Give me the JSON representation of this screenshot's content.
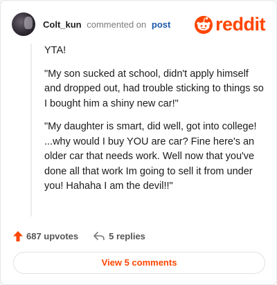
{
  "comment": {
    "username": "Colt_kun",
    "action": "commented on",
    "target": "post",
    "avatar_icon": "user-avatar-icon",
    "brand": {
      "name": "reddit",
      "icon": "reddit-snoo-icon",
      "color": "#ff4500"
    },
    "paragraphs": [
      "YTA!",
      "\"My son sucked at school, didn't apply himself and dropped out, had trouble sticking to things so I bought him a shiny new car!\"",
      "\"My daughter is smart, did well, got into college! ...why would I buy YOU are car? Fine here's an older car that needs work. Well now that you've done all that work Im going to sell it from under you! Hahaha I am the devil!!\""
    ],
    "upvotes_label": "687 upvotes",
    "upvote_icon": "upvote-arrow-icon",
    "upvote_color": "#ff4500",
    "replies_label": "5 replies",
    "reply_icon": "reply-arrow-icon",
    "view_button_label": "View 5 comments"
  }
}
